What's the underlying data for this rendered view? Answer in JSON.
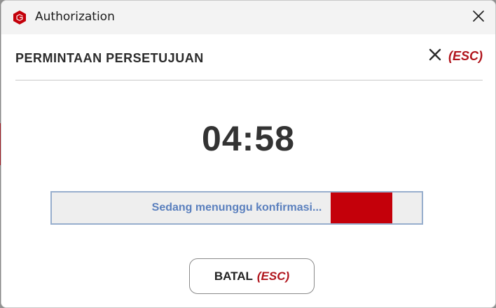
{
  "window": {
    "title": "Authorization",
    "app_icon": "hexagon-logo-icon",
    "close_icon": "close-icon"
  },
  "dialog": {
    "heading": "PERMINTAAN PERSETUJUAN",
    "close_icon": "close-x-icon",
    "close_shortcut": "(ESC)",
    "timer": "04:58",
    "progress": {
      "status_text": "Sedang menunggu konfirmasi...",
      "indeterminate": true
    },
    "cancel_button": {
      "label": "BATAL",
      "shortcut": "(ESC)"
    }
  },
  "colors": {
    "accent": "#c4000a",
    "esc_text": "#b0141c",
    "status_text": "#5b80be",
    "progress_border": "#97aecd"
  }
}
